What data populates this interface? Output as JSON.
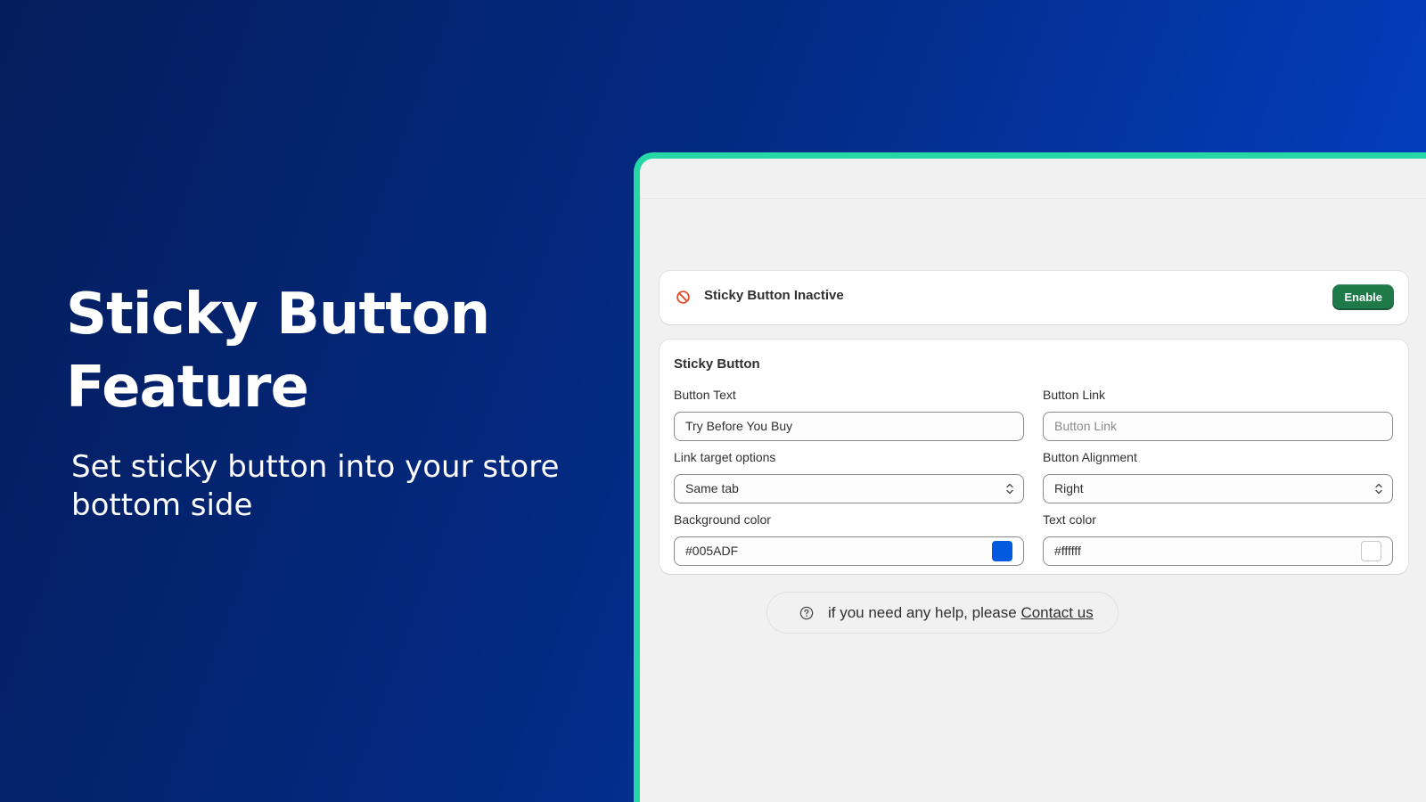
{
  "hero": {
    "title_line1": "Sticky Button",
    "title_line2": "Feature",
    "subtitle_line1": "Set sticky button into your store",
    "subtitle_line2": "bottom side"
  },
  "status": {
    "label": "Sticky Button Inactive",
    "icon": "prohibited-icon",
    "enable_label": "Enable"
  },
  "settings": {
    "title": "Sticky Button",
    "button_text": {
      "label": "Button Text",
      "value": "Try Before You Buy"
    },
    "button_link": {
      "label": "Button Link",
      "placeholder": "Button Link"
    },
    "link_target": {
      "label": "Link target options",
      "selected": "Same tab"
    },
    "alignment": {
      "label": "Button Alignment",
      "selected": "Right"
    },
    "background_color": {
      "label": "Background color",
      "value": "#005ADF",
      "swatch": "#005adf"
    },
    "text_color": {
      "label": "Text color",
      "value": "#ffffff",
      "swatch": "#ffffff"
    }
  },
  "help": {
    "text": "if you need any help, please ",
    "link": "Contact us",
    "icon": "question-circle-icon"
  },
  "colors": {
    "frame_accent": "#25d8a6",
    "enable_button": "#1f7a4a",
    "status_icon": "#e0502a"
  }
}
